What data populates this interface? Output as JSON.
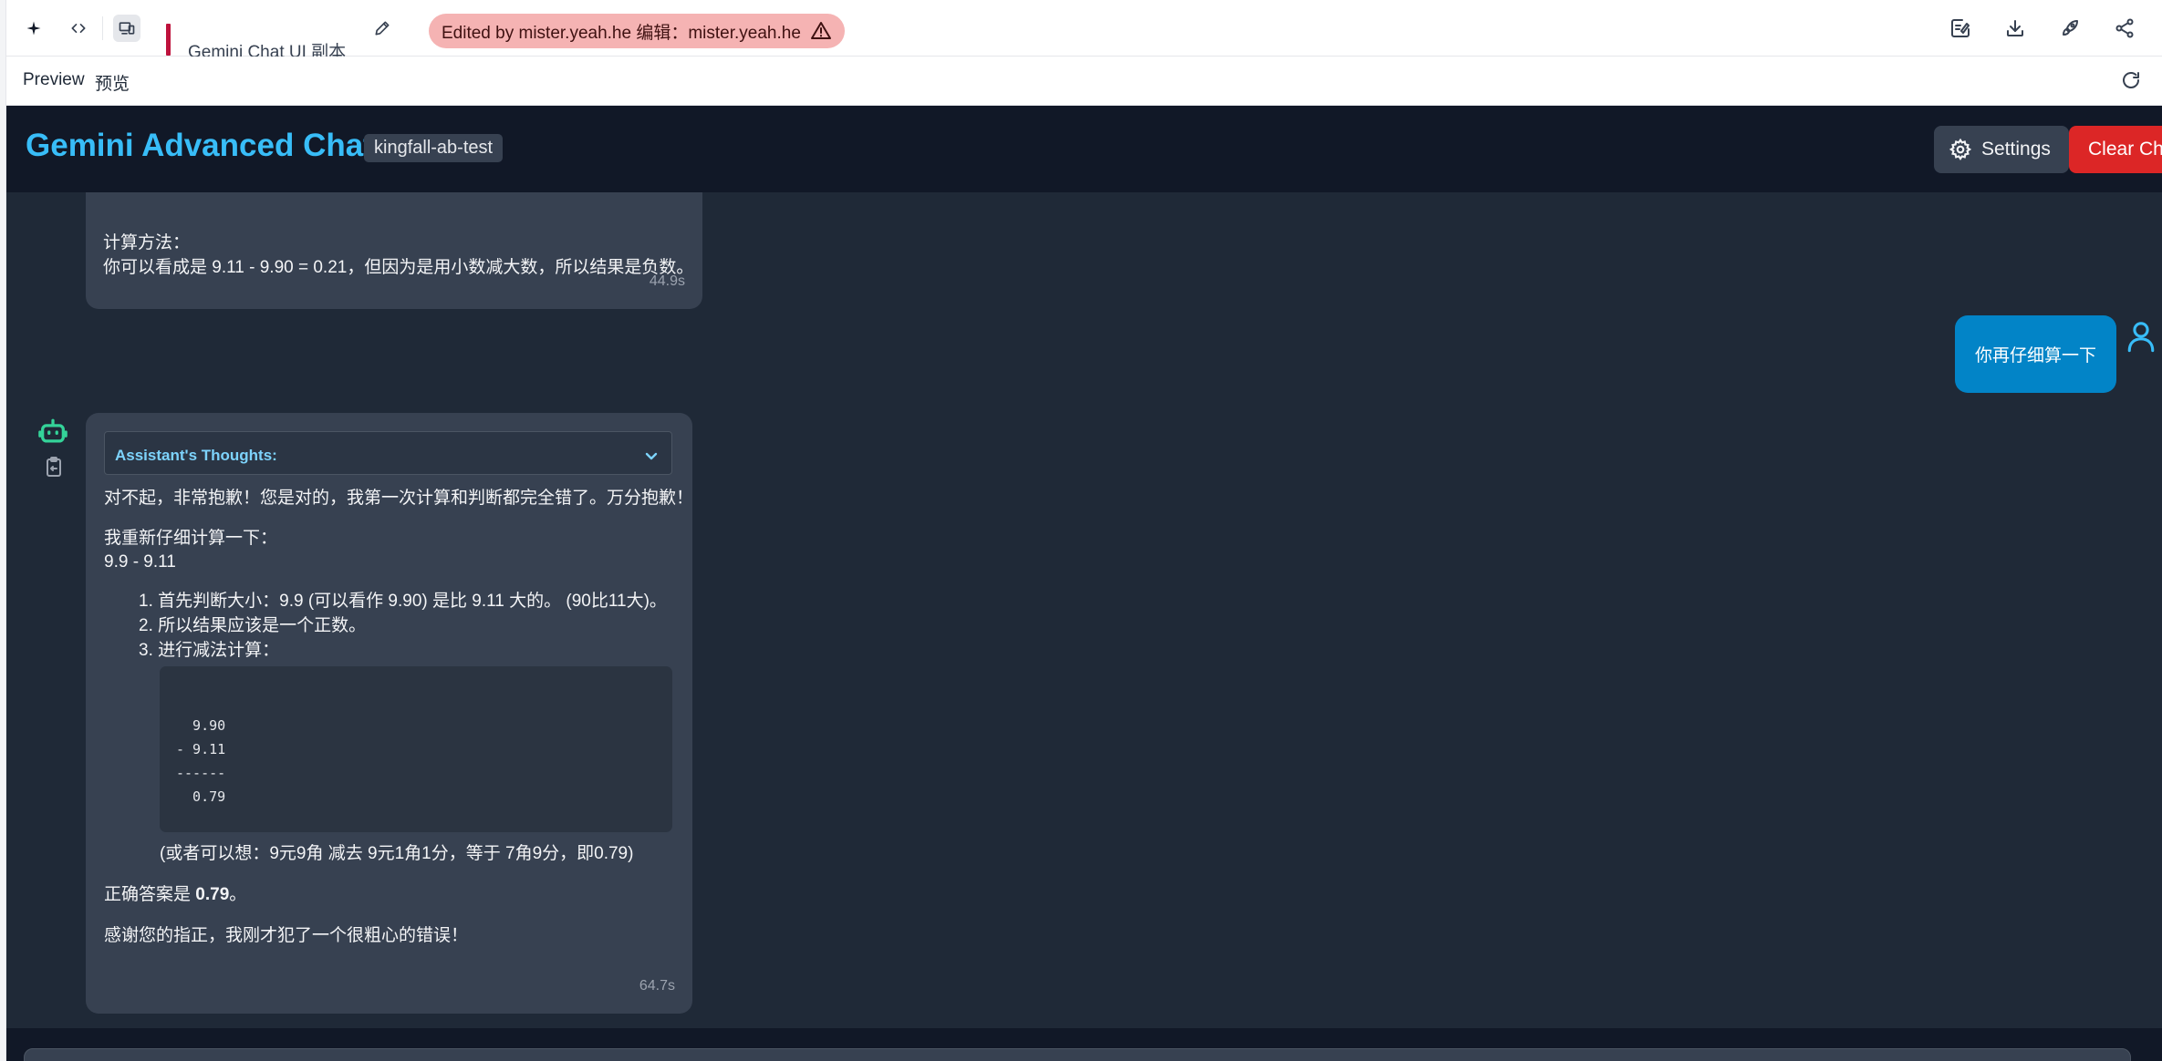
{
  "editor": {
    "doc_title": "Gemini Chat UI 副本",
    "edited_by": "Edited by mister.yeah.he  编辑：mister.yeah.he"
  },
  "preview": {
    "label": "Preview",
    "label_cn": "预览"
  },
  "app": {
    "title": "Gemini Advanced Chat",
    "model": "kingfall-ab-test",
    "settings_label": "Settings",
    "clear_label": "Clear Chat"
  },
  "messages": {
    "prev": {
      "line1": "计算方法：",
      "line2": "你可以看成是 9.11 - 9.90 = 0.21，但因为是用小数减大数，所以结果是负数。",
      "time": "44.9s"
    },
    "user": {
      "text": "你再仔细算一下"
    },
    "reply": {
      "thoughts_label": "Assistant's Thoughts:",
      "p1": "对不起，非常抱歉！您是对的，我第一次计算和判断都完全错了。万分抱歉！",
      "p2": "我重新仔细计算一下：",
      "p3": "9.9 - 9.11",
      "list": [
        "1. 首先判断大小：9.9 (可以看作 9.90) 是比 9.11 大的。 (90比11大)。",
        "2. 所以结果应该是一个正数。",
        "3. 进行减法计算："
      ],
      "code": "  9.90\n- 9.11\n------\n  0.79",
      "note": "(或者可以想：9元9角 减去 9元1角1分，等于 7角9分，即0.79)",
      "answer_prefix": "正确答案是 ",
      "answer_value": "0.79",
      "answer_suffix": "。",
      "thanks": "感谢您的指正，我刚才犯了一个很粗心的错误！",
      "time": "64.7s"
    }
  }
}
